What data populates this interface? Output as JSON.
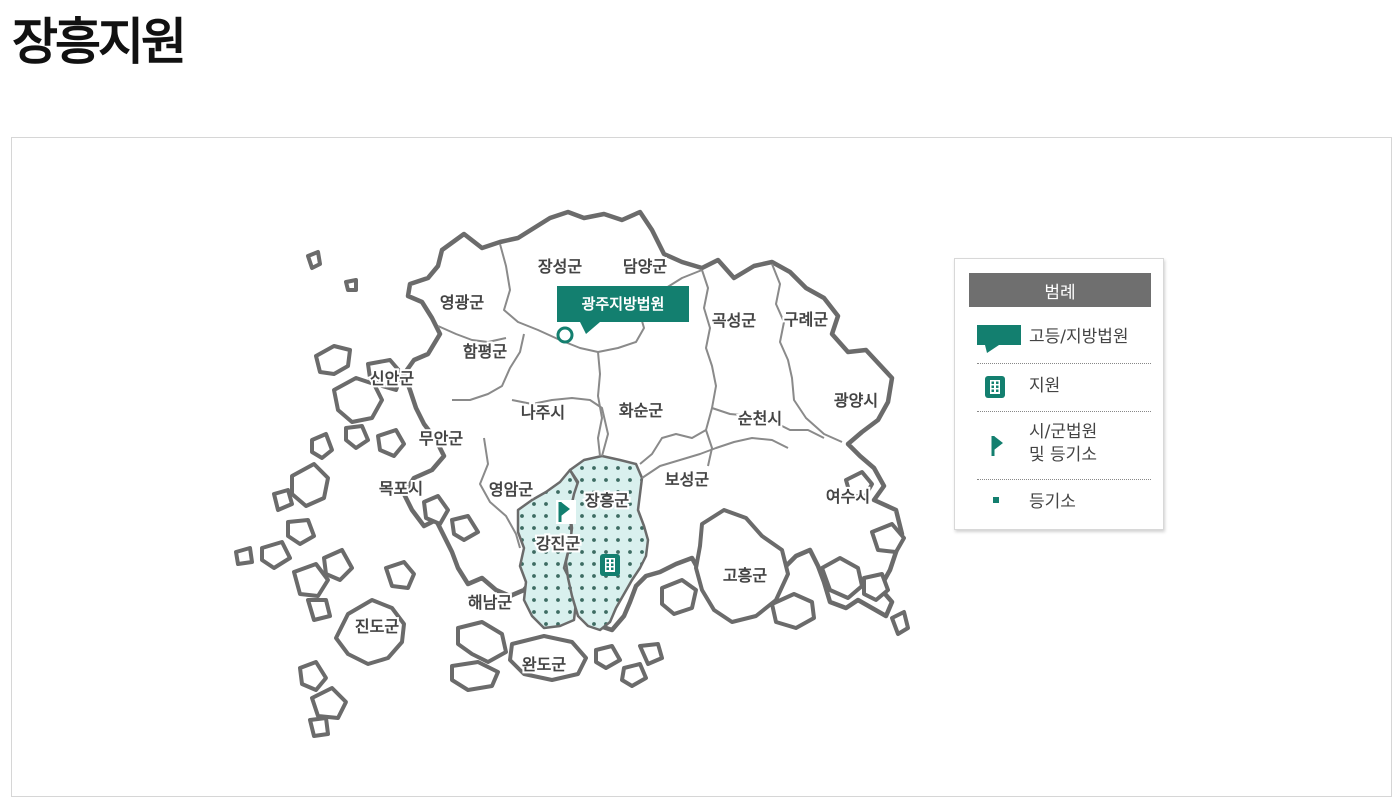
{
  "page": {
    "title": "장흥지원"
  },
  "court_label": "광주지방법원",
  "regions": {
    "jangseong": "장성군",
    "damyang": "담양군",
    "yeonggwang": "영광군",
    "gokseong": "곡성군",
    "gurye": "구례군",
    "hampyeong": "함평군",
    "sinan": "신안군",
    "naju": "나주시",
    "hwasun": "화순군",
    "suncheon": "순천시",
    "gwangyang": "광양시",
    "muan": "무안군",
    "mokpo": "목포시",
    "yeongam": "영암군",
    "jangheung": "장흥군",
    "boseong": "보성군",
    "yeosu": "여수시",
    "gangjin": "강진군",
    "goheung": "고흥군",
    "haenam": "해남군",
    "jindo": "진도군",
    "wando": "완도군"
  },
  "legend": {
    "title": "범례",
    "high_court": "고등/지방법원",
    "branch": "지원",
    "city_court_line1": "시/군법원",
    "city_court_line2": "및 등기소",
    "registry": "등기소"
  },
  "colors": {
    "accent": "#137f6f",
    "highlight_fill": "#d9f0ee",
    "outline": "#6b6b6b",
    "legend_header": "#6f6f6f"
  }
}
